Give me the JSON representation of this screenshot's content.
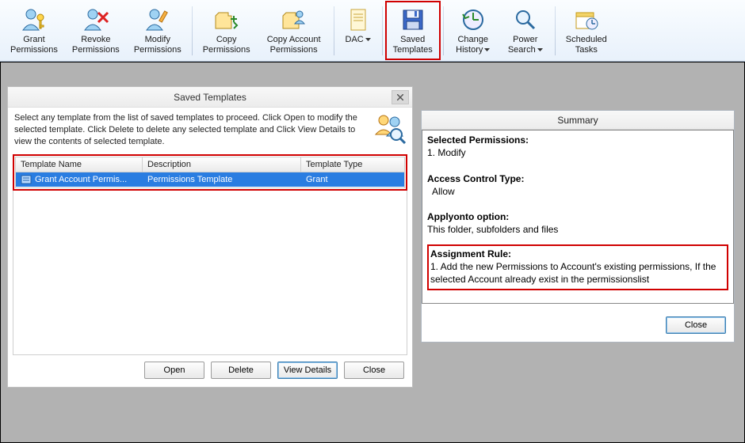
{
  "toolbar": {
    "grant": {
      "l1": "Grant",
      "l2": "Permissions"
    },
    "revoke": {
      "l1": "Revoke",
      "l2": "Permissions"
    },
    "modify": {
      "l1": "Modify",
      "l2": "Permissions"
    },
    "copy": {
      "l1": "Copy",
      "l2": "Permissions"
    },
    "copyacct": {
      "l1": "Copy Account",
      "l2": "Permissions"
    },
    "dac": {
      "l1": "DAC"
    },
    "saved": {
      "l1": "Saved",
      "l2": "Templates"
    },
    "history": {
      "l1": "Change",
      "l2": "History"
    },
    "power": {
      "l1": "Power",
      "l2": "Search"
    },
    "sched": {
      "l1": "Scheduled",
      "l2": "Tasks"
    }
  },
  "dlg": {
    "title": "Saved Templates",
    "intro": "Select any template from the list of saved templates to proceed. Click Open to modify the selected template. Click Delete to delete any selected template and Click View Details to view the contents of selected template.",
    "cols": {
      "name": "Template Name",
      "desc": "Description",
      "type": "Template Type"
    },
    "rows": [
      {
        "name": "Grant Account Permis...",
        "desc": "Permissions Template",
        "type": "Grant"
      }
    ],
    "btns": {
      "open": "Open",
      "delete": "Delete",
      "viewdetails": "View Details",
      "close": "Close"
    }
  },
  "summary": {
    "title": "Summary",
    "selperm_label": "Selected Permissions:",
    "selperm_val": "1. Modify",
    "acl_label": "Access Control Type:",
    "acl_val": "  Allow",
    "applyonto_label": "Applyonto option:",
    "applyonto_val": "This folder, subfolders and files",
    "assign_label": "Assignment Rule:",
    "assign_val": "1. Add the new Permissions to Account's existing permissions, If the selected Account already exist in the permissionslist",
    "close": "Close"
  }
}
